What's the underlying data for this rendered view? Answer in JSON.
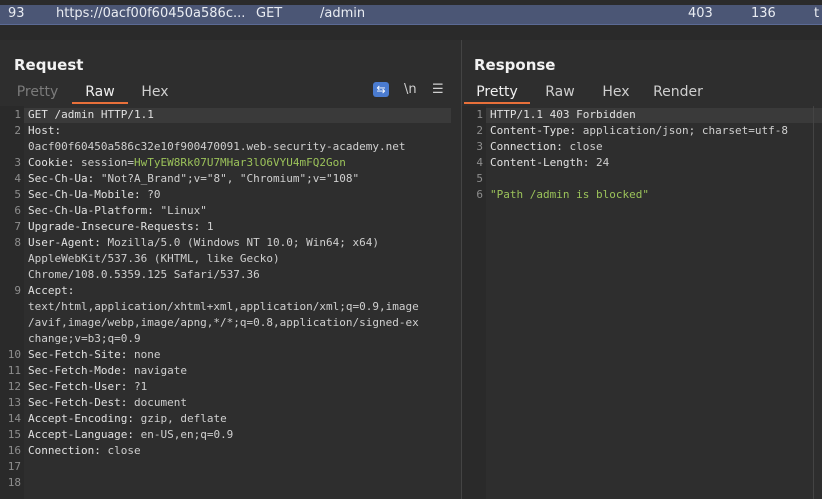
{
  "history_row": {
    "id": "93",
    "url": "https://0acf00f60450a586c...",
    "method": "GET",
    "path": "/admin",
    "status": "403",
    "length": "136",
    "extra": "t"
  },
  "request": {
    "title": "Request",
    "tabs": [
      "Pretty",
      "Raw",
      "Hex"
    ],
    "active_tab": "Raw",
    "tools": {
      "newline": "\\n",
      "menu": "☰",
      "wrap": "⇆"
    },
    "lines": [
      {
        "n": "1",
        "key": "GET /admin HTTP/1.1",
        "val": ""
      },
      {
        "n": "2",
        "key": "Host:",
        "val": ""
      },
      {
        "n": "",
        "key": "",
        "val": "0acf00f60450a586c32e10f900470091.web-security-academy.net"
      },
      {
        "n": "3",
        "key": "Cookie: ",
        "val": "session=",
        "val2": "HwTyEW8Rk07U7MHar3lO6VYU4mFQ2Gon"
      },
      {
        "n": "4",
        "key": "Sec-Ch-Ua: ",
        "val": "\"Not?A_Brand\";v=\"8\", \"Chromium\";v=\"108\""
      },
      {
        "n": "5",
        "key": "Sec-Ch-Ua-Mobile: ",
        "val": "?0"
      },
      {
        "n": "6",
        "key": "Sec-Ch-Ua-Platform: ",
        "val": "\"Linux\""
      },
      {
        "n": "7",
        "key": "Upgrade-Insecure-Requests: ",
        "val": "1"
      },
      {
        "n": "8",
        "key": "User-Agent: ",
        "val": "Mozilla/5.0 (Windows NT 10.0; Win64; x64)"
      },
      {
        "n": "",
        "key": "",
        "val": "AppleWebKit/537.36 (KHTML, like Gecko)"
      },
      {
        "n": "",
        "key": "",
        "val": "Chrome/108.0.5359.125 Safari/537.36"
      },
      {
        "n": "9",
        "key": "Accept:",
        "val": ""
      },
      {
        "n": "",
        "key": "",
        "val": "text/html,application/xhtml+xml,application/xml;q=0.9,image"
      },
      {
        "n": "",
        "key": "",
        "val": "/avif,image/webp,image/apng,*/*;q=0.8,application/signed-ex"
      },
      {
        "n": "",
        "key": "",
        "val": "change;v=b3;q=0.9"
      },
      {
        "n": "10",
        "key": "Sec-Fetch-Site: ",
        "val": "none"
      },
      {
        "n": "11",
        "key": "Sec-Fetch-Mode: ",
        "val": "navigate"
      },
      {
        "n": "12",
        "key": "Sec-Fetch-User: ",
        "val": "?1"
      },
      {
        "n": "13",
        "key": "Sec-Fetch-Dest: ",
        "val": "document"
      },
      {
        "n": "14",
        "key": "Accept-Encoding: ",
        "val": "gzip, deflate"
      },
      {
        "n": "15",
        "key": "Accept-Language: ",
        "val": "en-US,en;q=0.9"
      },
      {
        "n": "16",
        "key": "Connection: ",
        "val": "close"
      },
      {
        "n": "17",
        "key": "",
        "val": ""
      },
      {
        "n": "18",
        "key": "",
        "val": ""
      }
    ]
  },
  "response": {
    "title": "Response",
    "tabs": [
      "Pretty",
      "Raw",
      "Hex",
      "Render"
    ],
    "active_tab": "Pretty",
    "lines": [
      {
        "n": "1",
        "key": "HTTP/1.1 403 Forbidden",
        "val": ""
      },
      {
        "n": "2",
        "key": "Content-Type: ",
        "val": "application/json; charset=utf-8"
      },
      {
        "n": "3",
        "key": "Connection: ",
        "val": "close"
      },
      {
        "n": "4",
        "key": "Content-Length: ",
        "val": "24"
      },
      {
        "n": "5",
        "key": "",
        "val": ""
      },
      {
        "n": "6",
        "key": "",
        "val": "",
        "str": "\"Path /admin is blocked\""
      }
    ]
  }
}
